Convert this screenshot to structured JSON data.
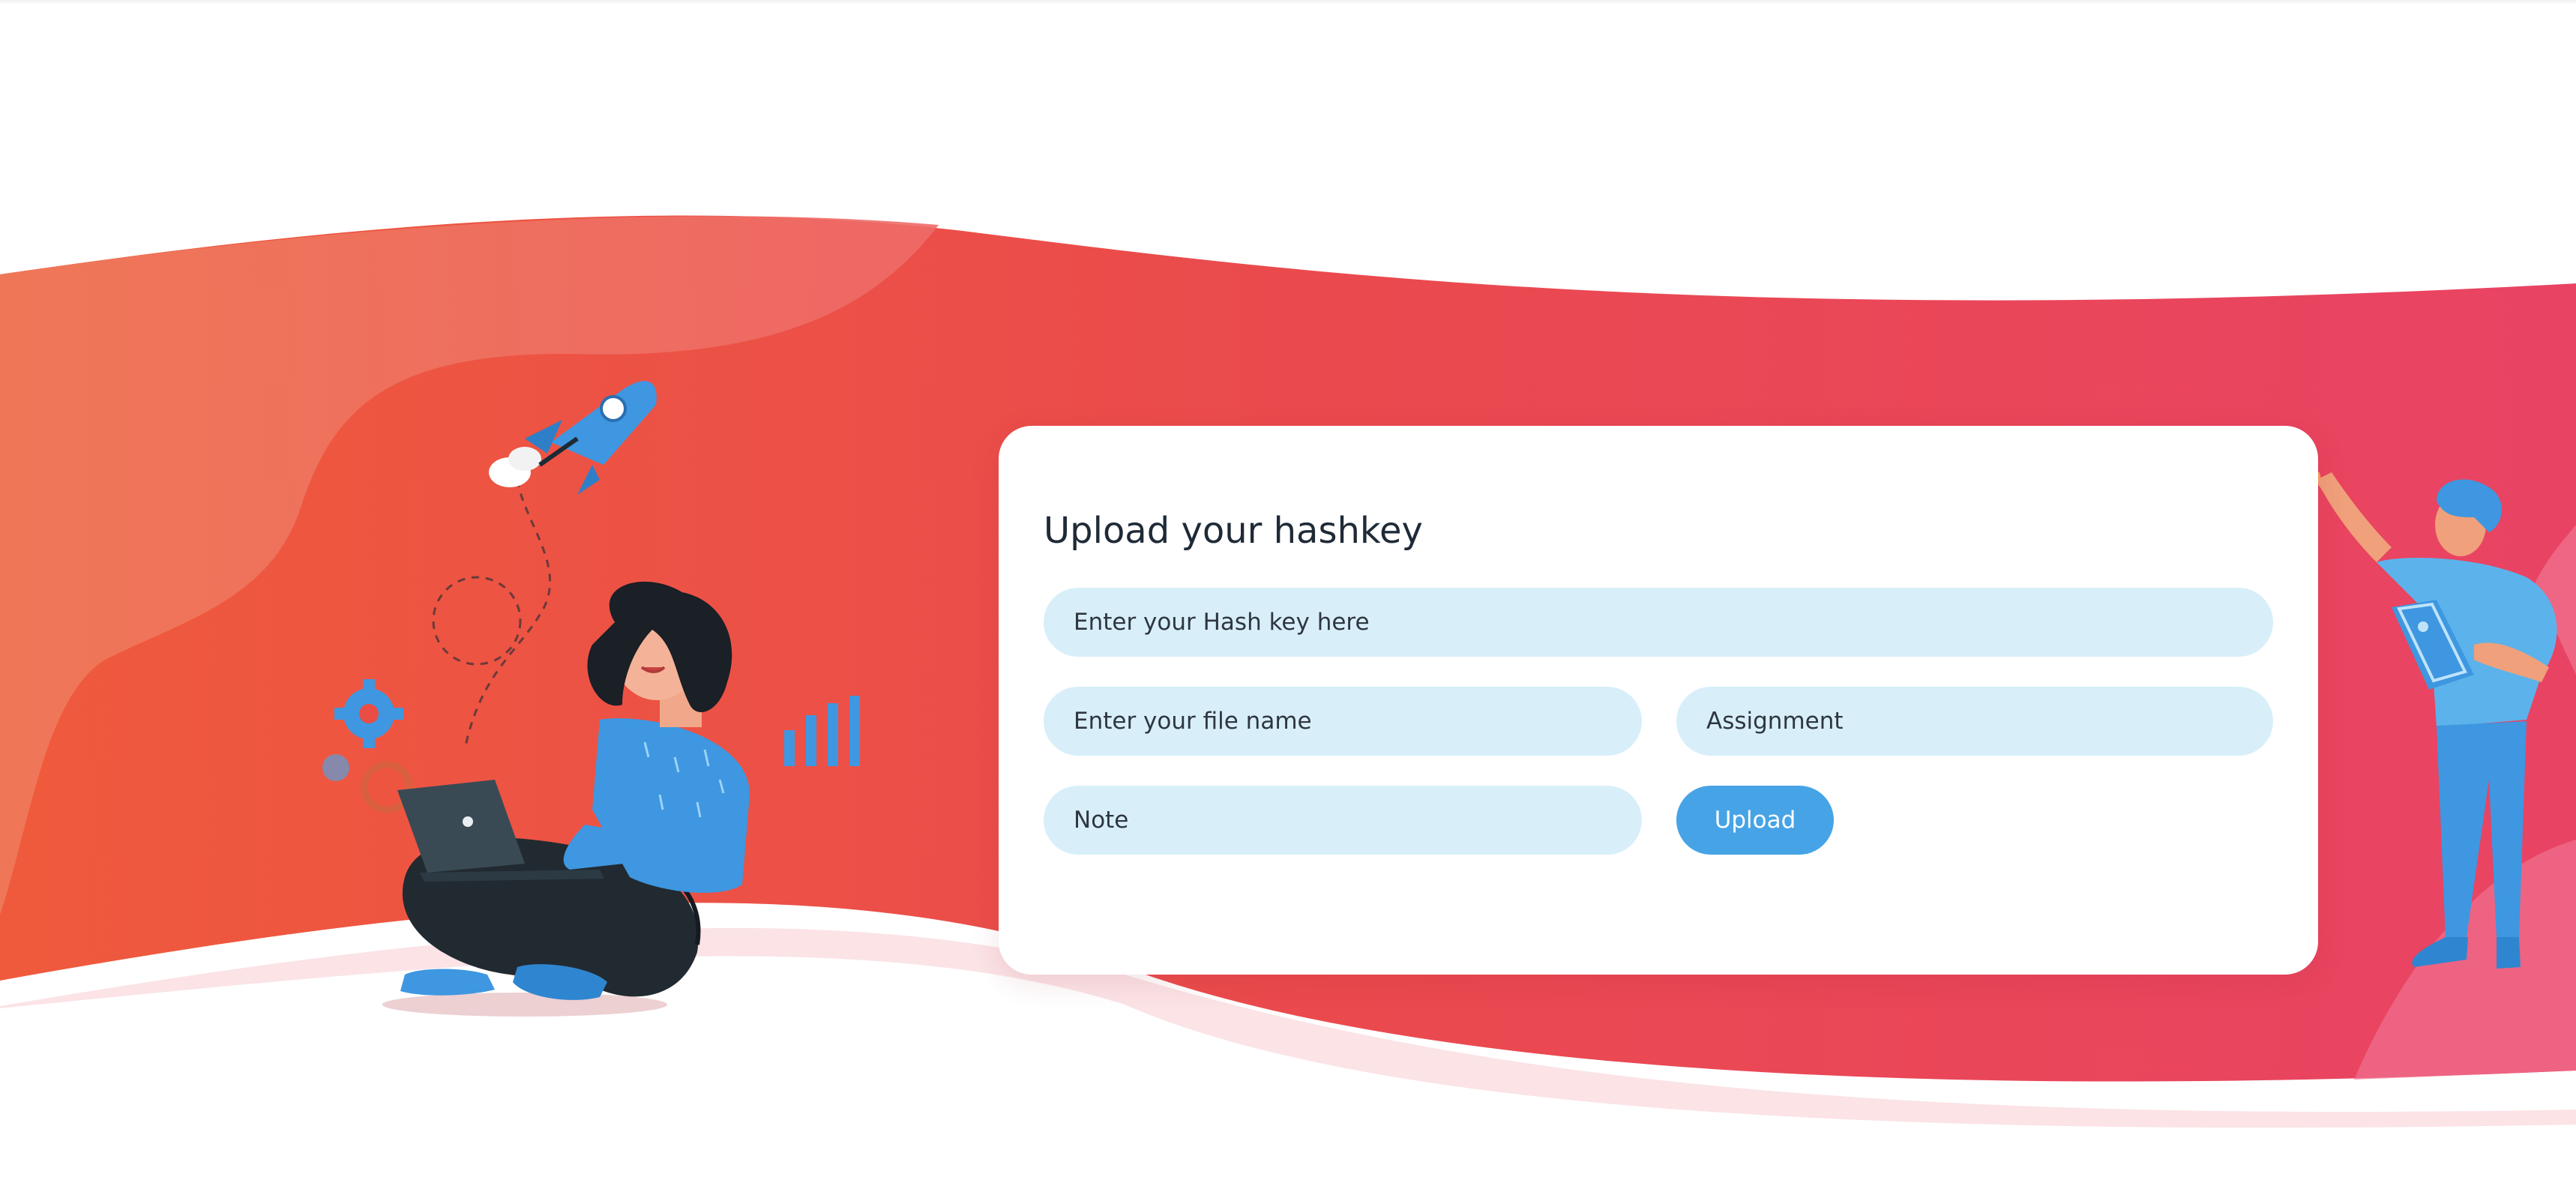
{
  "form": {
    "title": "Upload your hashkey",
    "hash_placeholder": "Enter your Hash key here",
    "file_placeholder": "Enter your file name",
    "assignment_placeholder": "Assignment",
    "note_placeholder": "Note",
    "upload_label": "Upload"
  },
  "theme": {
    "gradient_start": "#ee6b4d",
    "gradient_end": "#e94364",
    "input_bg": "#d8effa",
    "button_bg": "#46a3e6"
  },
  "illustrations": {
    "left": "woman-with-laptop-illustration",
    "right": "man-pointing-illustration"
  }
}
